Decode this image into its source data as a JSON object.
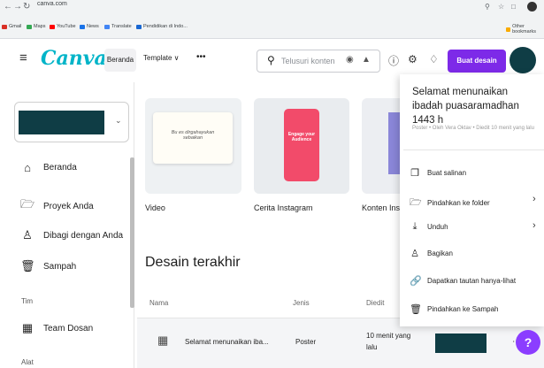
{
  "browser": {
    "url": "canva.com",
    "bookmarks": [
      "Gmail",
      "Maps",
      "YouTube",
      "News",
      "Translate",
      "Pendidikan di Indo..."
    ],
    "other_bookmarks": "Other bookmarks"
  },
  "header": {
    "logo": "Canva",
    "home": "Beranda",
    "template": "Template ∨",
    "more": "•••",
    "search_placeholder": "Telusuri konten",
    "cta": "Buat desain"
  },
  "sidebar": {
    "items": [
      {
        "label": "Beranda",
        "icon": "home-icon"
      },
      {
        "label": "Proyek Anda",
        "icon": "folder-icon"
      },
      {
        "label": "Dibagi dengan Anda",
        "icon": "shared-icon"
      },
      {
        "label": "Sampah",
        "icon": "trash-icon"
      }
    ],
    "section_team": "Tim",
    "team_item": "Team Dosan",
    "section_tools": "Alat"
  },
  "cards": [
    {
      "label": "Video",
      "art": "Bu es dirgahayukan sebaikan"
    },
    {
      "label": "Cerita Instagram",
      "art": "Engage your Audience"
    },
    {
      "label": "Konten Inst"
    }
  ],
  "recent": {
    "title": "Desain terakhir",
    "columns": [
      "Nama",
      "Jenis",
      "Diedit"
    ],
    "rows": [
      {
        "name": "Selamat menunaikan iba...",
        "type": "Poster",
        "edited": "10 menit yang lalu"
      }
    ]
  },
  "menu": {
    "title": "Selamat menunaikan ibadah puasaramadhan 1443 h",
    "subtitle": "Poster • Oleh Vera Oktav • Diedit 10 menit yang lalu",
    "items": [
      {
        "label": "Buat salinan",
        "icon": "copy-icon"
      },
      {
        "label": "Pindahkan ke folder",
        "icon": "folder-icon"
      },
      {
        "label": "Unduh",
        "icon": "download-icon"
      },
      {
        "label": "Bagikan",
        "icon": "share-icon"
      },
      {
        "label": "Dapatkan tautan hanya-lihat",
        "icon": "link-icon"
      },
      {
        "label": "Pindahkan ke Sampah",
        "icon": "trash-icon"
      }
    ]
  },
  "help": "?"
}
